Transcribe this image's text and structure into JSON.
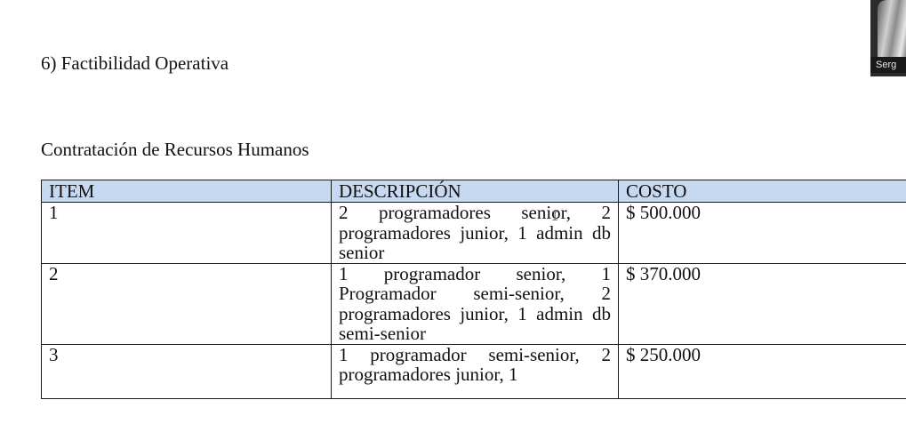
{
  "document": {
    "section_heading": "6) Factibilidad Operativa",
    "sub_heading": "Contratación de Recursos Humanos",
    "table": {
      "headers": [
        "ITEM",
        "DESCRIPCIÓN",
        "COSTO"
      ],
      "rows": [
        {
          "item": "1",
          "description": "2 programadores senior, 2 programadores junior, 1 admin db senior",
          "cost": "$ 500.000"
        },
        {
          "item": "2",
          "description": "1 programador senior, 1 Programador semi-senior, 2 programadores junior, 1 admin db semi-senior",
          "cost": "$ 370.000"
        },
        {
          "item": "3",
          "description": "1 programador semi-senior, 2 programadores junior, 1",
          "cost": "$ 250.000"
        }
      ]
    },
    "header_fill_color": "#c6d9f1"
  },
  "video_call": {
    "participant_name": "Serg"
  },
  "cursor": {
    "icon": "text-cursor-icon",
    "glyph": "I"
  }
}
